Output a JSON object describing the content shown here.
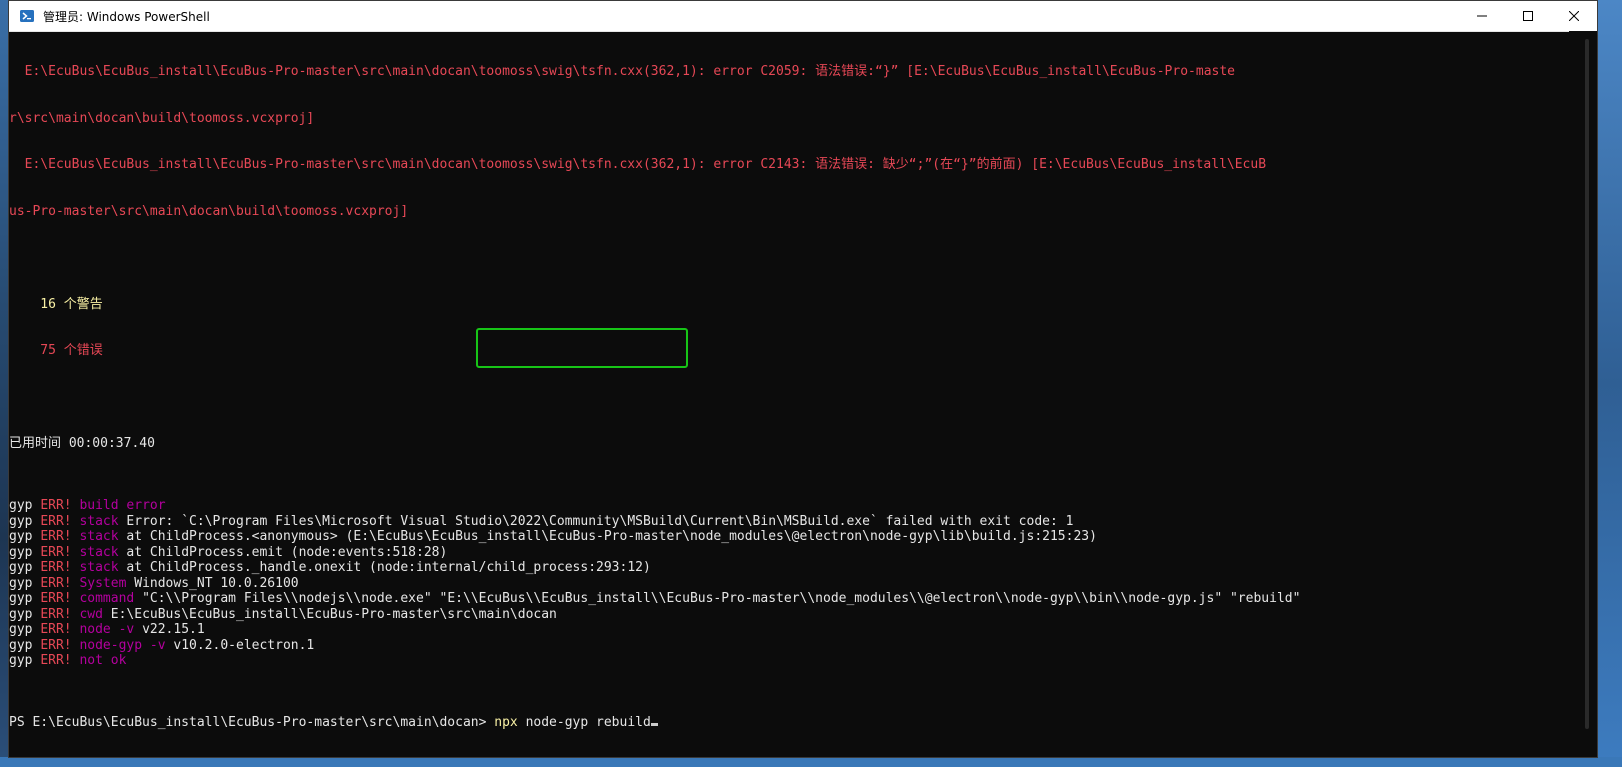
{
  "window": {
    "title": "管理员: Windows PowerShell",
    "minimize_label": "—",
    "maximize_label": "☐",
    "close_label": "✕"
  },
  "console": {
    "err1_a": "  E:\\EcuBus\\EcuBus_install\\EcuBus-Pro-master\\src\\main\\docan\\toomoss\\swig\\tsfn.cxx(362,1): error C2059: 语法错误:“}” [E:\\EcuBus\\EcuBus_install\\EcuBus-Pro-maste",
    "err1_b": "r\\src\\main\\docan\\build\\toomoss.vcxproj]",
    "err2_a": "  E:\\EcuBus\\EcuBus_install\\EcuBus-Pro-master\\src\\main\\docan\\toomoss\\swig\\tsfn.cxx(362,1): error C2143: 语法错误: 缺少“;”(在“}”的前面) [E:\\EcuBus\\EcuBus_install\\EcuB",
    "err2_b": "us-Pro-master\\src\\main\\docan\\build\\toomoss.vcxproj]",
    "warnings": "    16 个警告",
    "errors": "    75 个错误",
    "elapsed": "已用时间 00:00:37.40",
    "gyp_lines": [
      {
        "prefix": "gyp ",
        "err": "ERR!",
        "key": " build error",
        "rest": ""
      },
      {
        "prefix": "gyp ",
        "err": "ERR!",
        "key": " stack",
        "rest": " Error: `C:\\Program Files\\Microsoft Visual Studio\\2022\\Community\\MSBuild\\Current\\Bin\\MSBuild.exe` failed with exit code: 1"
      },
      {
        "prefix": "gyp ",
        "err": "ERR!",
        "key": " stack",
        "rest": " at ChildProcess.<anonymous> (E:\\EcuBus\\EcuBus_install\\EcuBus-Pro-master\\node_modules\\@electron\\node-gyp\\lib\\build.js:215:23)"
      },
      {
        "prefix": "gyp ",
        "err": "ERR!",
        "key": " stack",
        "rest": " at ChildProcess.emit (node:events:518:28)"
      },
      {
        "prefix": "gyp ",
        "err": "ERR!",
        "key": " stack",
        "rest": " at ChildProcess._handle.onexit (node:internal/child_process:293:12)"
      },
      {
        "prefix": "gyp ",
        "err": "ERR!",
        "key": " System",
        "rest": " Windows_NT 10.0.26100"
      },
      {
        "prefix": "gyp ",
        "err": "ERR!",
        "key": " command",
        "rest": " \"C:\\\\Program Files\\\\nodejs\\\\node.exe\" \"E:\\\\EcuBus\\\\EcuBus_install\\\\EcuBus-Pro-master\\\\node_modules\\\\@electron\\\\node-gyp\\\\bin\\\\node-gyp.js\" \"rebuild\""
      },
      {
        "prefix": "gyp ",
        "err": "ERR!",
        "key": " cwd",
        "rest": " E:\\EcuBus\\EcuBus_install\\EcuBus-Pro-master\\src\\main\\docan"
      },
      {
        "prefix": "gyp ",
        "err": "ERR!",
        "key": " node -v",
        "rest": " v22.15.1"
      },
      {
        "prefix": "gyp ",
        "err": "ERR!",
        "key": " node-gyp -v",
        "rest": " v10.2.0-electron.1"
      },
      {
        "prefix": "gyp ",
        "err": "ERR!",
        "key": " not ok",
        "rest": ""
      }
    ],
    "prompt": "PS E:\\EcuBus\\EcuBus_install\\EcuBus-Pro-master\\src\\main\\docan> ",
    "command_exe": "npx",
    "command_args": " node-gyp rebuild"
  },
  "colors": {
    "error_red": "#e74856",
    "warning_yellow": "#f9f1a5",
    "gyp_magenta": "#b4009e",
    "highlight_green": "#17c517",
    "console_bg": "#0c0c0c"
  }
}
